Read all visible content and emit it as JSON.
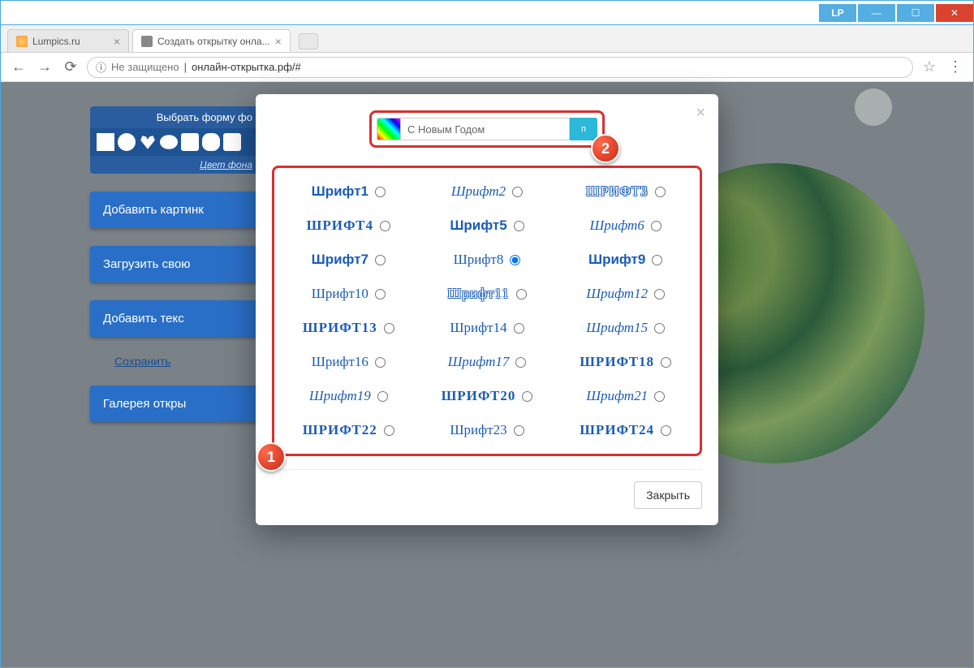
{
  "titlebar": {
    "user_badge": "LP"
  },
  "tabs": [
    {
      "title": "Lumpics.ru",
      "favicon": "orange"
    },
    {
      "title": "Создать открытку онла...",
      "favicon": "grey"
    }
  ],
  "address": {
    "security_label": "Не защищено",
    "url": "онлайн-открытка.рф/#"
  },
  "sidebar": {
    "shape_header": "Выбрать форму фо",
    "bg_color_link": "Цвет фона",
    "add_picture": "Добавить картинк",
    "upload_own": "Загрузить свою",
    "add_text": "Добавить текс",
    "save_link": "Сохранить",
    "gallery": "Галерея откры"
  },
  "modal": {
    "text_value": "С Новым Годом",
    "size_indicator": "п",
    "close_button": "Закрыть",
    "fonts": [
      {
        "label": "Шрифт1",
        "class": "f-regular",
        "checked": false
      },
      {
        "label": "Шрифт2",
        "class": "f-script",
        "checked": false
      },
      {
        "label": "ШРИФТ3",
        "class": "f-outline",
        "checked": false
      },
      {
        "label": "ШРИФТ4",
        "class": "f-block",
        "checked": false
      },
      {
        "label": "Шрифт5",
        "class": "f-regular",
        "checked": false
      },
      {
        "label": "Шрифт6",
        "class": "f-script",
        "checked": false
      },
      {
        "label": "Шрифт7",
        "class": "f-regular",
        "checked": false
      },
      {
        "label": "Шрифт8",
        "class": "f-hand",
        "checked": true
      },
      {
        "label": "Шрифт9",
        "class": "f-regular",
        "checked": false
      },
      {
        "label": "Шрифт10",
        "class": "f-thin",
        "checked": false
      },
      {
        "label": "Шрифт11",
        "class": "f-outline",
        "checked": false
      },
      {
        "label": "Шрифт12",
        "class": "f-script",
        "checked": false
      },
      {
        "label": "ШРИФТ13",
        "class": "f-block",
        "checked": false
      },
      {
        "label": "Шрифт14",
        "class": "f-thin",
        "checked": false
      },
      {
        "label": "Шрифт15",
        "class": "f-script",
        "checked": false
      },
      {
        "label": "Шрифт16",
        "class": "f-thin",
        "checked": false
      },
      {
        "label": "Шрифт17",
        "class": "f-script",
        "checked": false
      },
      {
        "label": "ШРИФТ18",
        "class": "f-block",
        "checked": false
      },
      {
        "label": "Шрифт19",
        "class": "f-script",
        "checked": false
      },
      {
        "label": "ШРИФТ20",
        "class": "f-block",
        "checked": false
      },
      {
        "label": "Шрифт21",
        "class": "f-script",
        "checked": false
      },
      {
        "label": "ШРИФТ22",
        "class": "f-block",
        "checked": false
      },
      {
        "label": "Шрифт23",
        "class": "f-thin",
        "checked": false
      },
      {
        "label": "ШРИФТ24",
        "class": "f-block",
        "checked": false
      }
    ],
    "markers": {
      "one": "1",
      "two": "2"
    }
  }
}
